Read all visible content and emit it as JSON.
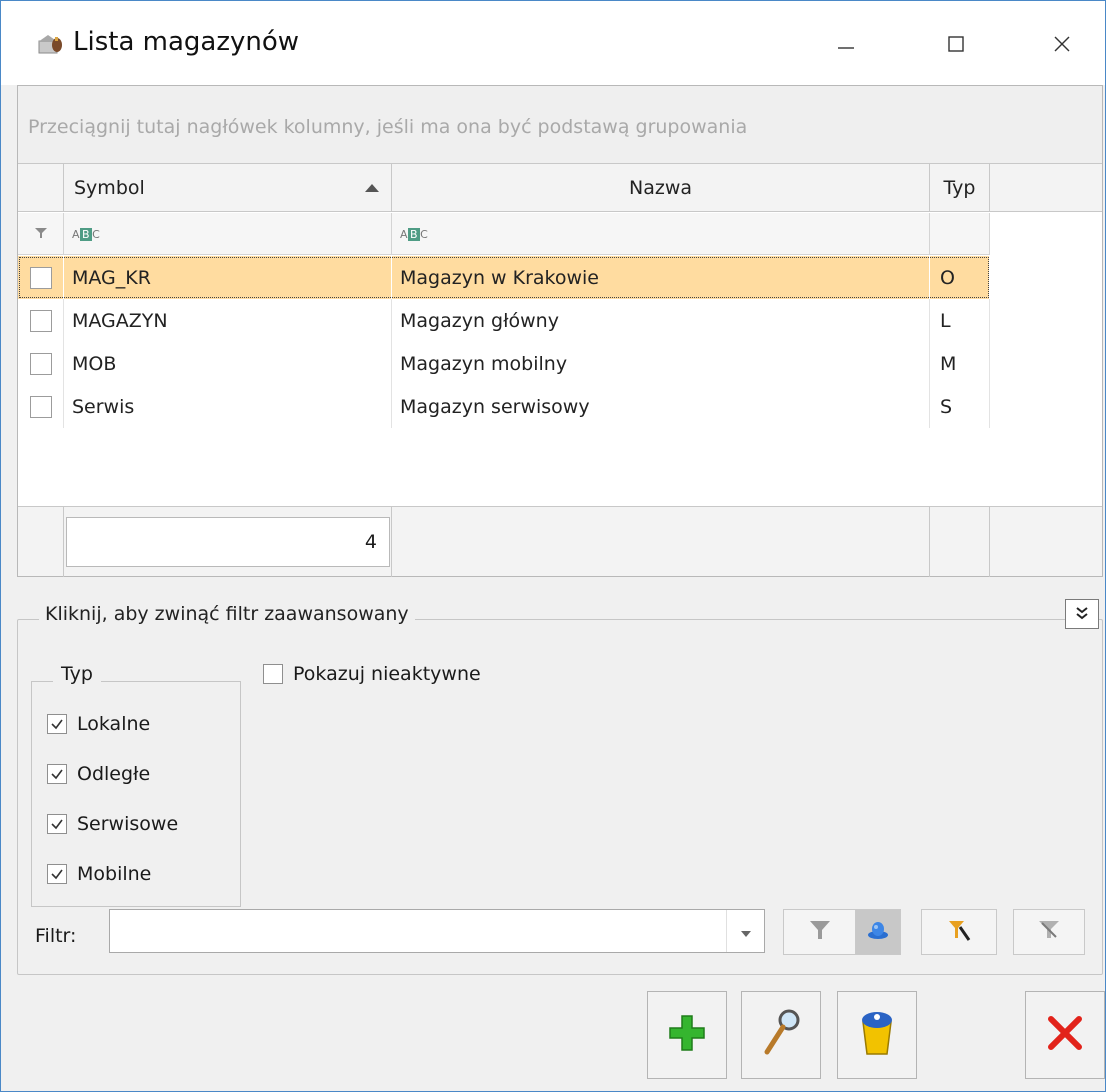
{
  "window": {
    "title": "Lista magazynów"
  },
  "grid": {
    "group_hint": "Przeciągnij tutaj nagłówek kolumny, jeśli ma ona być podstawą grupowania",
    "columns": {
      "symbol": "Symbol",
      "nazwa": "Nazwa",
      "typ": "Typ"
    },
    "sort": {
      "column": "Symbol",
      "direction": "ascending"
    },
    "rows": [
      {
        "symbol": "MAG_KR",
        "nazwa": "Magazyn w Krakowie",
        "typ": "O",
        "selected": true
      },
      {
        "symbol": "MAGAZYN",
        "nazwa": "Magazyn główny",
        "typ": "L",
        "selected": false
      },
      {
        "symbol": "MOB",
        "nazwa": "Magazyn mobilny",
        "typ": "M",
        "selected": false
      },
      {
        "symbol": "Serwis",
        "nazwa": "Magazyn serwisowy",
        "typ": "S",
        "selected": false
      }
    ],
    "count": "4"
  },
  "advanced_filter": {
    "toggle_label": "Kliknij, aby zwinąć filtr zaawansowany",
    "typ_group_label": "Typ",
    "typ_options": [
      {
        "label": "Lokalne",
        "checked": true
      },
      {
        "label": "Odległe",
        "checked": true
      },
      {
        "label": "Serwisowe",
        "checked": true
      },
      {
        "label": "Mobilne",
        "checked": true
      }
    ],
    "show_inactive_label": "Pokazuj nieaktywne",
    "show_inactive_checked": false,
    "filter_label": "Filtr:",
    "filter_value": ""
  },
  "icons": {
    "title": "warehouse-icon",
    "add": "plus-icon",
    "edit": "magnifier-icon",
    "delete": "trash-icon",
    "close": "close-x-icon"
  },
  "colors": {
    "selected_row": "#ffdca0",
    "add_green": "#35b52f",
    "close_red": "#e2231a",
    "window_border": "#4a88c7"
  }
}
